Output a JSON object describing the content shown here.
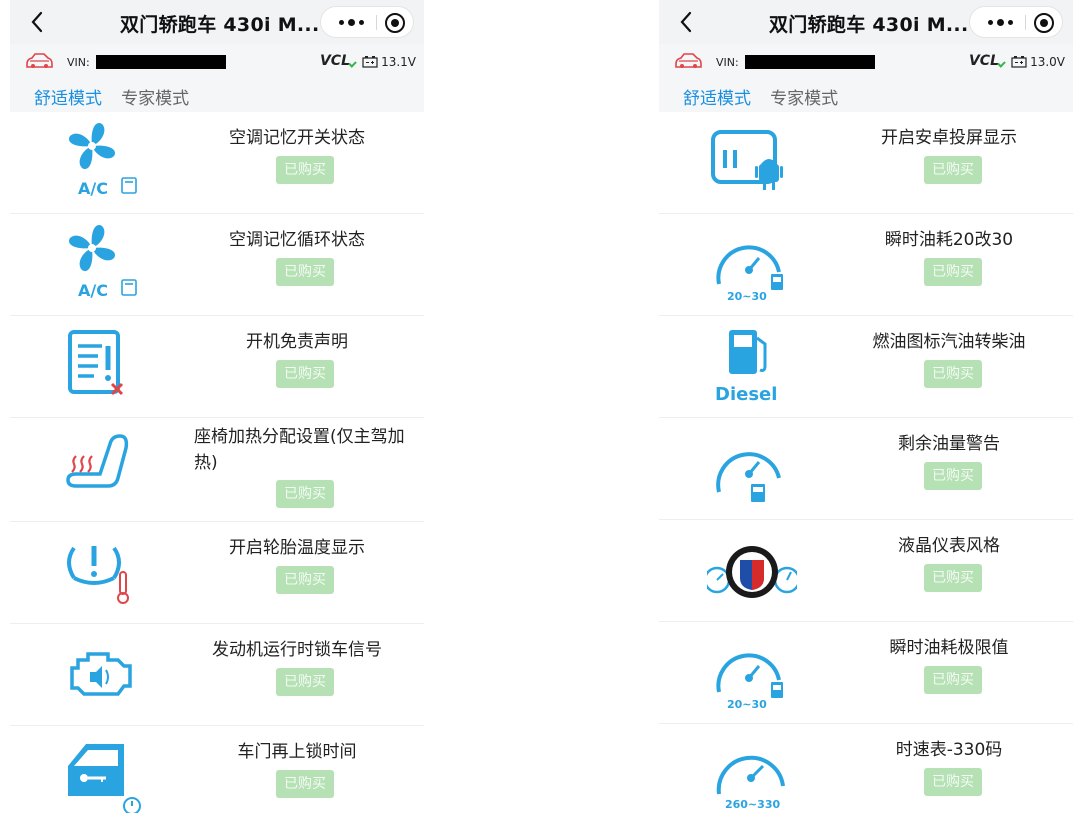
{
  "screens": [
    {
      "nav": {
        "title": "双门轿跑车 430i M..."
      },
      "vin": {
        "label": "VIN:",
        "vcl": "VCL",
        "voltage": "13.1V"
      },
      "tabs": [
        "舒适模式",
        "专家模式"
      ],
      "items": [
        {
          "name": "空调记忆开关状态",
          "button": "已购买",
          "icon": "ac-fan-memory-icon",
          "icon_text": "A/C"
        },
        {
          "name": "空调记忆循环状态",
          "button": "已购买",
          "icon": "ac-fan-memory-icon",
          "icon_text": "A/C"
        },
        {
          "name": "开机免责声明",
          "button": "已购买",
          "icon": "disclaimer-document-icon",
          "icon_text": ""
        },
        {
          "name": "座椅加热分配设置(仅主驾加热)",
          "button": "已购买",
          "icon": "seat-heating-icon",
          "icon_text": ""
        },
        {
          "name": "开启轮胎温度显示",
          "button": "已购买",
          "icon": "tire-temperature-icon",
          "icon_text": ""
        },
        {
          "name": "发动机运行时锁车信号",
          "button": "已购买",
          "icon": "engine-sound-icon",
          "icon_text": ""
        },
        {
          "name": "车门再上锁时间",
          "button": "已购买",
          "icon": "door-key-timer-icon",
          "icon_text": ""
        }
      ]
    },
    {
      "nav": {
        "title": "双门轿跑车 430i M..."
      },
      "vin": {
        "label": "VIN:",
        "vcl": "VCL",
        "voltage": "13.0V"
      },
      "tabs": [
        "舒适模式",
        "专家模式"
      ],
      "items": [
        {
          "name": "开启安卓投屏显示",
          "button": "已购买",
          "icon": "android-screen-cast-icon",
          "icon_text": ""
        },
        {
          "name": "瞬时油耗20改30",
          "button": "已购买",
          "icon": "fuel-gauge-icon",
          "icon_text": "20~30"
        },
        {
          "name": "燃油图标汽油转柴油",
          "button": "已购买",
          "icon": "diesel-pump-icon",
          "icon_text": "Diesel"
        },
        {
          "name": "剩余油量警告",
          "button": "已购买",
          "icon": "fuel-gauge-icon",
          "icon_text": ""
        },
        {
          "name": "液晶仪表风格",
          "button": "已购买",
          "icon": "alpina-cluster-icon",
          "icon_text": ""
        },
        {
          "name": "瞬时油耗极限值",
          "button": "已购买",
          "icon": "fuel-gauge-icon",
          "icon_text": "20~30"
        },
        {
          "name": "时速表-330码",
          "button": "已购买",
          "icon": "speedometer-icon",
          "icon_text": "260~330"
        }
      ]
    }
  ],
  "colors": {
    "accent": "#1a8fe0",
    "icon_blue": "#2aa4e0",
    "buy_green": "#b5e1b5",
    "warning_red": "#e0454a"
  }
}
